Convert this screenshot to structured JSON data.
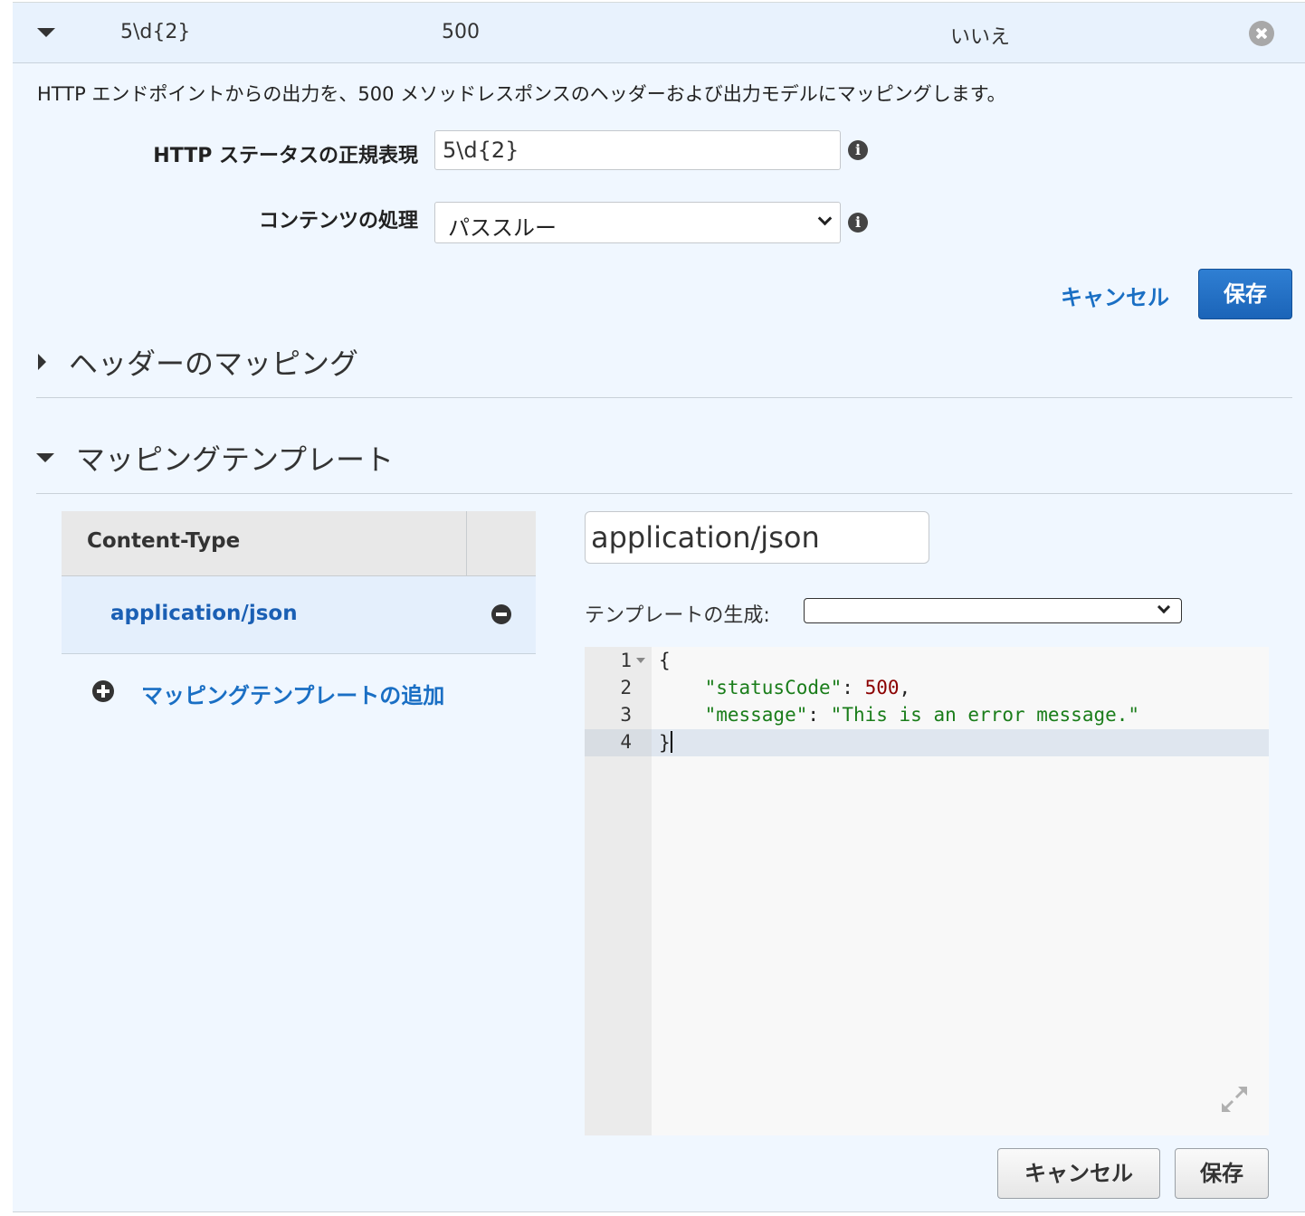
{
  "response_row": {
    "regex": "5\\d{2}",
    "status_code": "500",
    "default": "いいえ"
  },
  "description": "HTTP エンドポイントからの出力を、500 メソッドレスポンスのヘッダーおよび出力モデルにマッピングします。",
  "form": {
    "regex_label": "HTTP ステータスの正規表現",
    "regex_value": "5\\d{2}",
    "content_handling_label": "コンテンツの処理",
    "content_handling_value": "パススルー",
    "cancel_label": "キャンセル",
    "save_label": "保存"
  },
  "sections": {
    "header_mappings": "ヘッダーのマッピング",
    "mapping_templates": "マッピングテンプレート"
  },
  "content_type_table": {
    "header": "Content-Type",
    "rows": [
      "application/json"
    ],
    "add_label": "マッピングテンプレートの追加"
  },
  "template_editor": {
    "content_type_value": "application/json",
    "generate_label": "テンプレートの生成:",
    "generate_value": "",
    "line_numbers": [
      "1",
      "2",
      "3",
      "4"
    ],
    "code": {
      "open_brace": "{",
      "key1": "\"statusCode\"",
      "colon1": ": ",
      "val1": "500",
      "comma1": ",",
      "key2": "\"message\"",
      "colon2": ": ",
      "val2": "\"This is an error message.\"",
      "close_brace": "}"
    }
  },
  "footer": {
    "cancel_label": "キャンセル",
    "save_label": "保存"
  },
  "colors": {
    "panel_bg": "#f0f7ff",
    "link_blue": "#1a6fc4",
    "primary_button": "#1b64b8",
    "string_token": "#1a7d1a",
    "number_token": "#8b0000"
  },
  "icons": [
    "caret-down-icon",
    "caret-right-icon",
    "close-icon",
    "info-icon",
    "chevron-down-icon",
    "minus-circle-icon",
    "plus-circle-icon",
    "fold-arrow-icon",
    "expand-icon"
  ]
}
